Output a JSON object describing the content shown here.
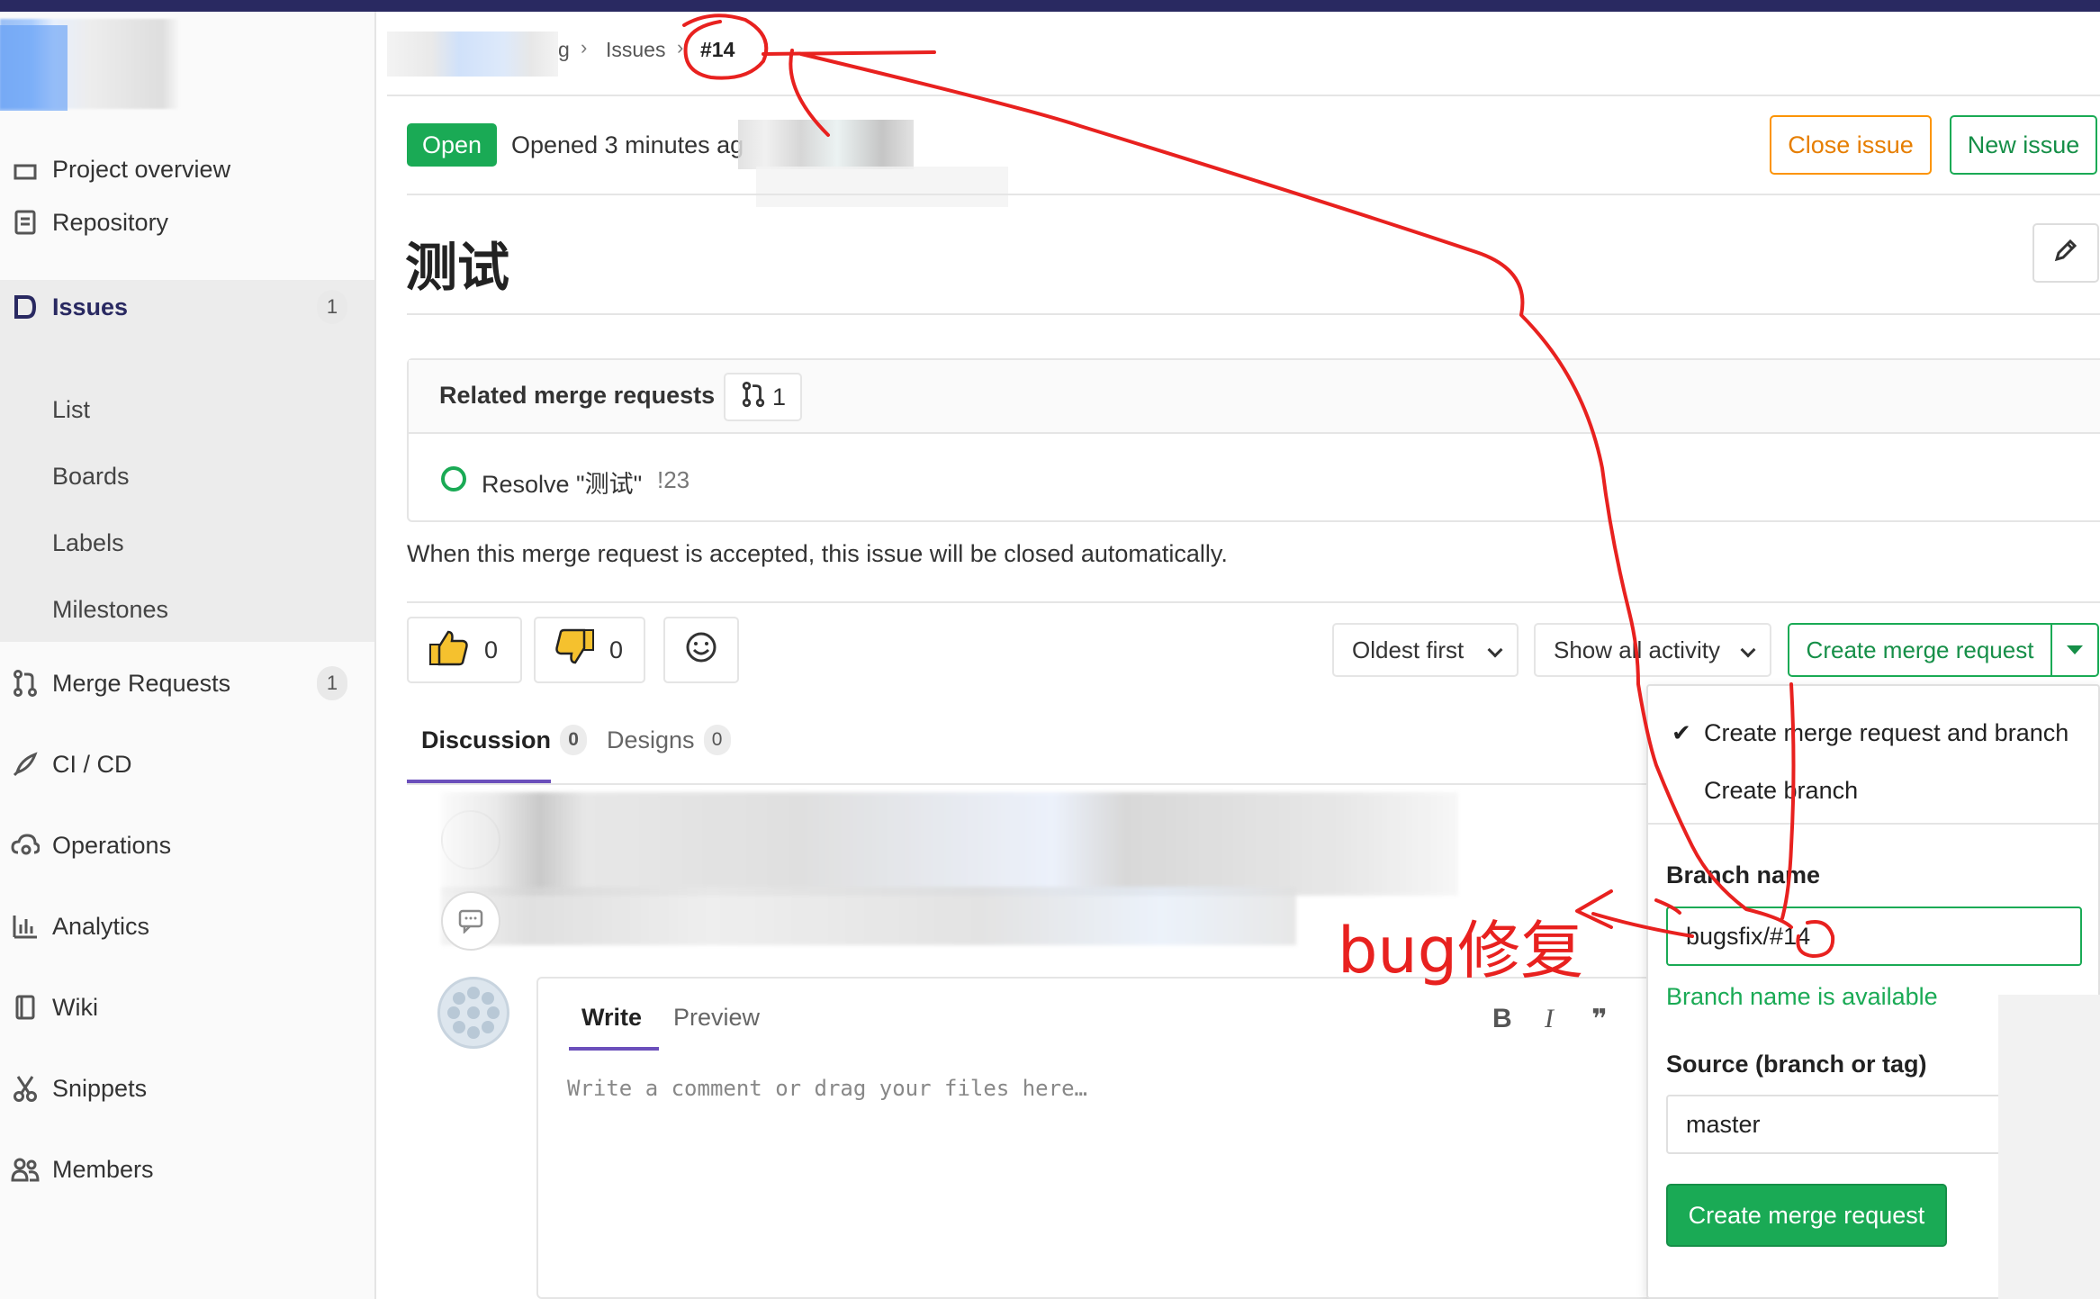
{
  "sidebar": {
    "items": [
      {
        "label": "Project overview",
        "icon": "home-icon"
      },
      {
        "label": "Repository",
        "icon": "doc-icon"
      },
      {
        "label": "Issues",
        "icon": "issues-icon",
        "count": "1"
      },
      {
        "label": "Merge Requests",
        "icon": "merge-request-icon",
        "count": "1"
      },
      {
        "label": "CI / CD",
        "icon": "rocket-icon"
      },
      {
        "label": "Operations",
        "icon": "cloud-gear-icon"
      },
      {
        "label": "Analytics",
        "icon": "chart-icon"
      },
      {
        "label": "Wiki",
        "icon": "book-icon"
      },
      {
        "label": "Snippets",
        "icon": "scissors-icon"
      },
      {
        "label": "Members",
        "icon": "users-icon"
      }
    ],
    "issues_sub": [
      "List",
      "Boards",
      "Labels",
      "Milestones"
    ]
  },
  "breadcrumb": {
    "partial": "g",
    "issues": "Issues",
    "current": "#14"
  },
  "issue": {
    "status": "Open",
    "opened": "Opened 3 minutes ag",
    "title": "测试",
    "close_label": "Close issue",
    "new_label": "New issue"
  },
  "related": {
    "title": "Related merge requests",
    "count": "1",
    "mr_title": "Resolve \"测试\"",
    "mr_ref": "!23",
    "auto_close": "When this merge request is accepted, this issue will be closed automatically."
  },
  "awards": {
    "thumbs_up": "0",
    "thumbs_down": "0"
  },
  "controls": {
    "sort": "Oldest first",
    "filter": "Show all activity",
    "create_mr": "Create merge request"
  },
  "tabs": {
    "discussion": "Discussion",
    "discussion_count": "0",
    "designs": "Designs",
    "designs_count": "0"
  },
  "editor": {
    "write": "Write",
    "preview": "Preview",
    "bold": "B",
    "italic": "I",
    "quote": "99",
    "placeholder": "Write a comment or drag your files here…"
  },
  "dropdown": {
    "option_mr_branch": "Create merge request and branch",
    "option_branch": "Create branch",
    "branch_label": "Branch name",
    "branch_value": "bugsfix/#14",
    "branch_ok": "Branch name is available",
    "source_label": "Source (branch or tag)",
    "source_value": "master",
    "submit": "Create merge request"
  },
  "annotation": {
    "text": "bug修复",
    "color": "#e8211f"
  }
}
